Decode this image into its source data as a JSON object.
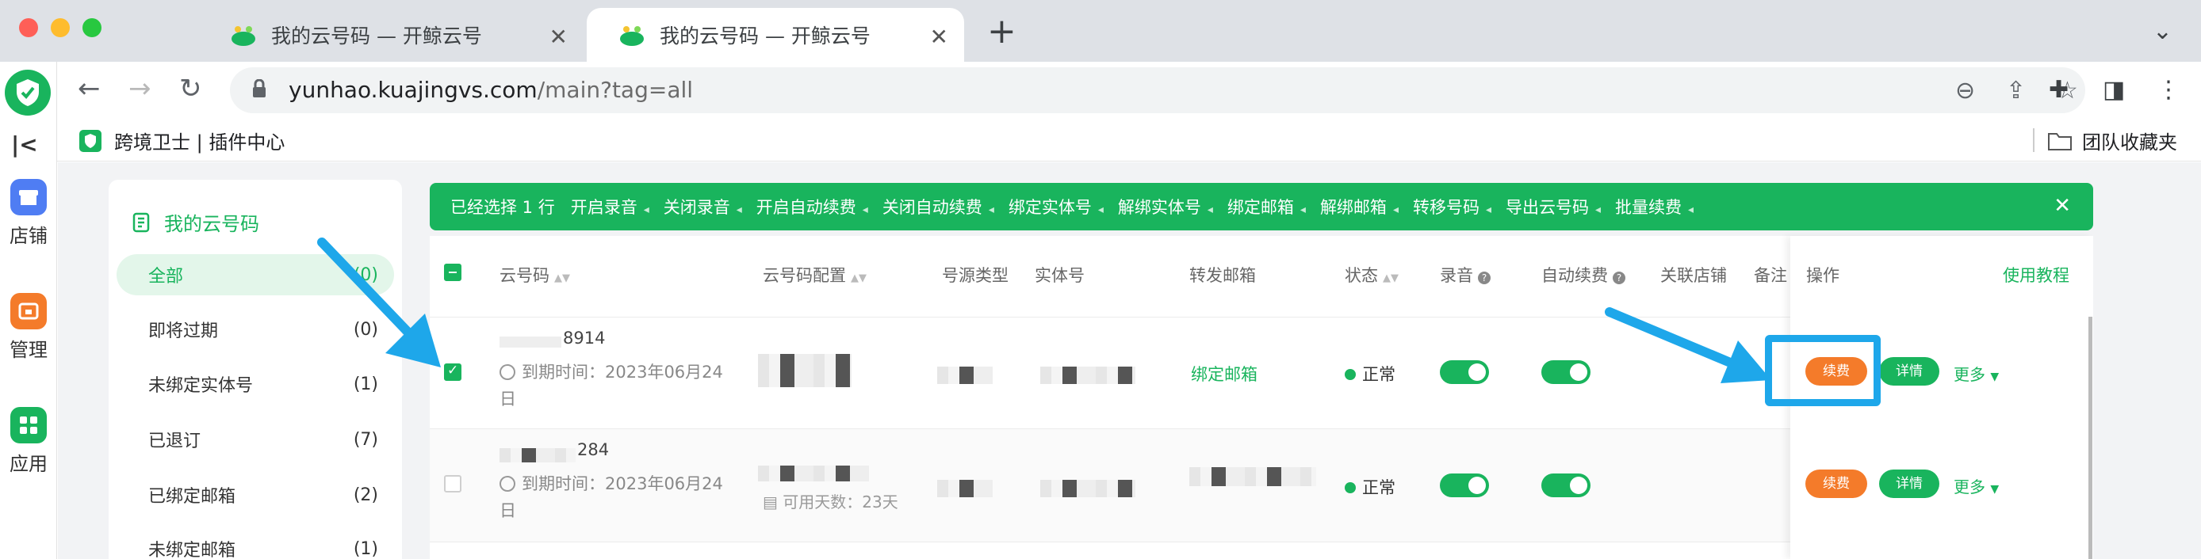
{
  "browser": {
    "tabs": [
      {
        "title": "我的云号码 — 开鲸云号"
      },
      {
        "title": "我的云号码 — 开鲸云号"
      }
    ],
    "url_host": "yunhao.kuajingvs.com",
    "url_path": "/main?tag=all",
    "bookmark": "跨境卫士 | 插件中心",
    "bookmark_folder": "团队收藏夹"
  },
  "rail": {
    "items": [
      {
        "label": "店铺",
        "color": "#4f7df3"
      },
      {
        "label": "管理",
        "color": "#f47b2a"
      },
      {
        "label": "应用",
        "color": "#19b45d"
      }
    ]
  },
  "sidebar": {
    "title": "我的云号码",
    "items": [
      {
        "label": "全部",
        "count": "(0)"
      },
      {
        "label": "即将过期",
        "count": "(0)"
      },
      {
        "label": "未绑定实体号",
        "count": "(1)"
      },
      {
        "label": "已退订",
        "count": "(7)"
      },
      {
        "label": "已绑定邮箱",
        "count": "(2)"
      },
      {
        "label": "未绑定邮箱",
        "count": "(1)"
      }
    ]
  },
  "actionbar": {
    "selected": "已经选择 1 行",
    "actions": [
      "开启录音",
      "关闭录音",
      "开启自动续费",
      "关闭自动续费",
      "绑定实体号",
      "解绑实体号",
      "绑定邮箱",
      "解绑邮箱",
      "转移号码",
      "导出云号码",
      "批量续费"
    ]
  },
  "table": {
    "headers": {
      "number": "云号码",
      "config": "云号码配置",
      "source": "号源类型",
      "physical": "实体号",
      "forward": "转发邮箱",
      "status": "状态",
      "record": "录音",
      "autorenew": "自动续费",
      "shop": "关联店铺",
      "note": "备注",
      "ops": "操作"
    },
    "tutorial": "使用教程",
    "rows": [
      {
        "number": "8914",
        "expire": "到期时间：2023年06月24日",
        "forward": "绑定邮箱",
        "status": "正常",
        "checked": true
      },
      {
        "number": "284",
        "expire": "到期时间：2023年06月24日",
        "days": "可用天数：23天",
        "status": "正常",
        "checked": false
      }
    ],
    "renew_label": "续费",
    "detail_label": "详情",
    "more_label": "更多"
  },
  "colors": {
    "accent": "#19b45d",
    "renew": "#f47b2a",
    "annotation": "#1ea7ea"
  }
}
